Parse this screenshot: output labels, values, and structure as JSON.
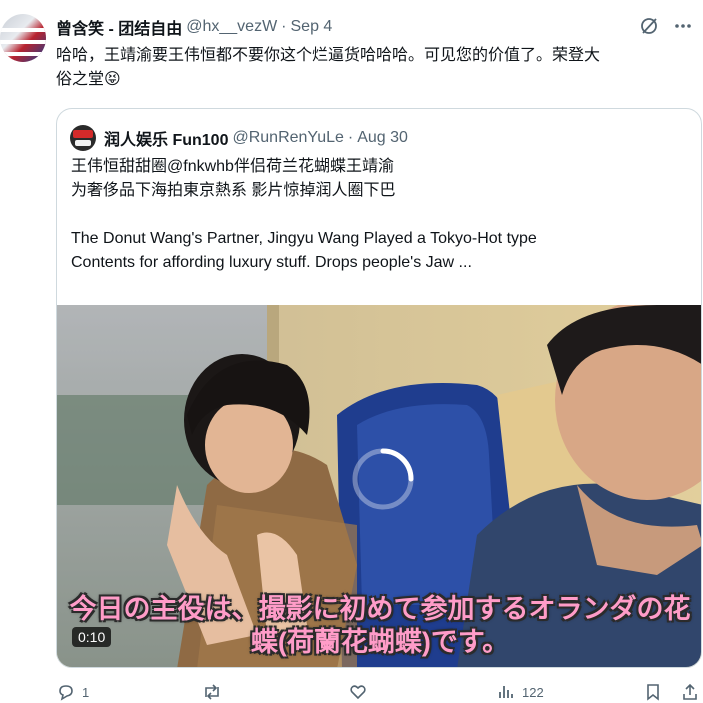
{
  "tweet": {
    "author_name": "曾含笑 - 团结自由",
    "handle": "@hx__vezW",
    "separator": "·",
    "date": "Sep 4",
    "text_line1": "哈哈，王靖渝要王伟恒都不要你这个烂逼货哈哈哈。可见您的价值了。荣登大",
    "text_line2": "俗之堂😝"
  },
  "quote": {
    "author_name": "润人娱乐 Fun100",
    "handle": "@RunRenYuLe",
    "separator": "·",
    "date": "Aug 30",
    "text_line1": "王伟恒甜甜圈@fnkwhb伴侣荷兰花蝴蝶王靖渝",
    "text_line2": "为奢侈品下海拍東京熱系 影片惊掉润人圈下巴",
    "text_line3": "The Donut Wang's Partner, Jingyu Wang Played a Tokyo-Hot type",
    "text_line4": "Contents for affording luxury stuff.  Drops people's Jaw ...",
    "video": {
      "subtitle_line1": "今日の主役は、撮影に初めて参加するオランダの花",
      "subtitle_line2": "蝶(荷蘭花蝴蝶)です。",
      "duration": "0:10"
    }
  },
  "actions": {
    "reply_count": "1",
    "views_count": "122"
  },
  "colors": {
    "secondary_text": "#536471",
    "border": "#cfd9de",
    "subtitle_fill": "#ff9cc8"
  }
}
